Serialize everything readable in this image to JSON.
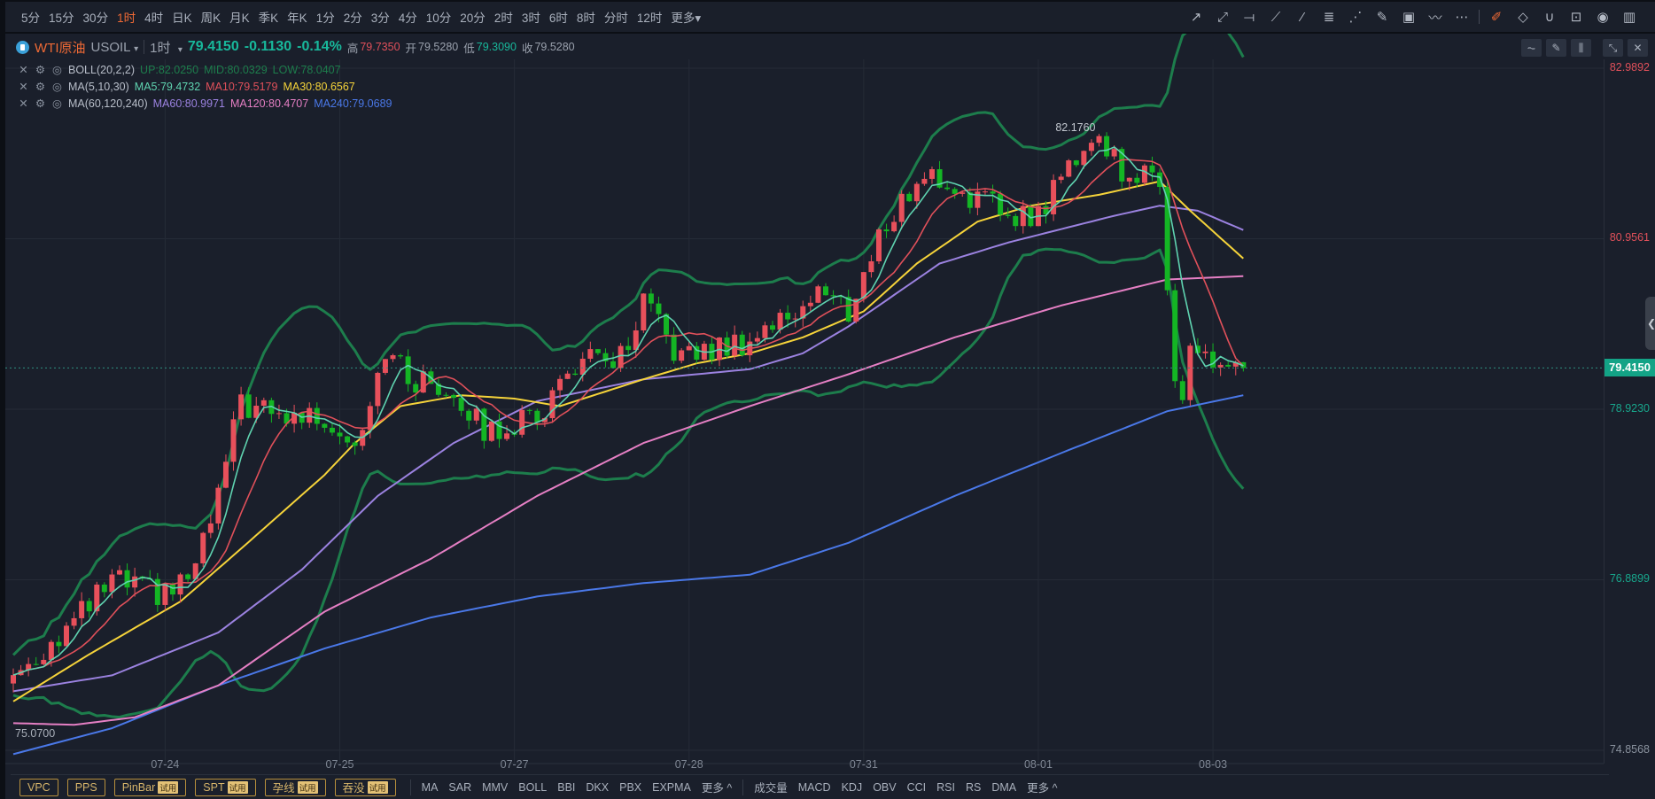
{
  "timeframes": [
    "5分",
    "15分",
    "30分",
    "1时",
    "4时",
    "日K",
    "周K",
    "月K",
    "季K",
    "年K",
    "1分",
    "2分",
    "3分",
    "4分",
    "10分",
    "20分",
    "2时",
    "3时",
    "6时",
    "8时",
    "分时",
    "12时",
    "更多▾"
  ],
  "active_timeframe": "1时",
  "drawing_tools": [
    {
      "icon": "arrow-line-icon",
      "glyph": "↗"
    },
    {
      "icon": "dashed-arrow-icon",
      "glyph": "⤢"
    },
    {
      "icon": "horizontal-line-icon",
      "glyph": "⟞"
    },
    {
      "icon": "price-range-icon",
      "glyph": "⟋"
    },
    {
      "icon": "segment-icon",
      "glyph": "⁄"
    },
    {
      "icon": "fibonacci-icon",
      "glyph": "≣"
    },
    {
      "icon": "fan-icon",
      "glyph": "⋰"
    },
    {
      "icon": "brush-icon",
      "glyph": "✎"
    },
    {
      "icon": "image-icon",
      "glyph": "▣"
    },
    {
      "icon": "pattern-icon",
      "glyph": "〰"
    },
    {
      "icon": "more-icon",
      "glyph": "⋯"
    }
  ],
  "edit_tools": [
    {
      "icon": "draw-mode-icon",
      "glyph": "✐",
      "active": true
    },
    {
      "icon": "eraser-icon",
      "glyph": "◇"
    },
    {
      "icon": "magnet-icon",
      "glyph": "∪"
    },
    {
      "icon": "unlock-icon",
      "glyph": "⊡"
    },
    {
      "icon": "eye-icon",
      "glyph": "◉"
    },
    {
      "icon": "trash-icon",
      "glyph": "▥"
    }
  ],
  "symbol": {
    "name": "WTI原油",
    "code": "USOIL",
    "interval": "1时",
    "price": "79.4150",
    "change": "-0.1130",
    "change_pct": "-0.14%",
    "high_label": "高",
    "high": "79.7350",
    "open_label": "开",
    "open": "79.5280",
    "low_label": "低",
    "low": "79.3090",
    "close_label": "收",
    "close": "79.5280"
  },
  "legend": [
    {
      "name": "BOLL(20,2,2)",
      "values": [
        {
          "t": "UP:82.0250",
          "c": "#1d7d4c"
        },
        {
          "t": "MID:80.0329",
          "c": "#1d7d4c"
        },
        {
          "t": "LOW:78.0407",
          "c": "#1d7d4c"
        }
      ]
    },
    {
      "name": "MA(5,10,30)",
      "values": [
        {
          "t": "MA5:79.4732",
          "c": "#5fd3b0"
        },
        {
          "t": "MA10:79.5179",
          "c": "#e0505a"
        },
        {
          "t": "MA30:80.6567",
          "c": "#f5d33a"
        }
      ]
    },
    {
      "name": "MA(60,120,240)",
      "values": [
        {
          "t": "MA60:80.9971",
          "c": "#9b82e0"
        },
        {
          "t": "MA120:80.4707",
          "c": "#e57fc4"
        },
        {
          "t": "MA240:79.0689",
          "c": "#4a78e8"
        }
      ]
    }
  ],
  "mini_buttons": [
    {
      "icon": "indicator-icon",
      "glyph": "⏦"
    },
    {
      "icon": "pen-icon",
      "glyph": "✎"
    },
    {
      "icon": "candle-type-icon",
      "glyph": "⫼"
    },
    {
      "icon": "shrink-icon",
      "glyph": "⤡"
    },
    {
      "icon": "close-icon",
      "glyph": "✕"
    }
  ],
  "axis_labels": [
    {
      "t": "82.9892",
      "p": 82.9892,
      "c": "#e0505a"
    },
    {
      "t": "80.9561",
      "p": 80.9561,
      "c": "#e0505a"
    },
    {
      "t": "78.9230",
      "p": 78.923,
      "c": "#18a68c"
    },
    {
      "t": "76.8899",
      "p": 76.8899,
      "c": "#18a68c"
    },
    {
      "t": "74.8568",
      "p": 74.8568,
      "c": "#8a929e"
    }
  ],
  "current_price": {
    "t": "79.4150",
    "p": 79.415
  },
  "dates": [
    {
      "t": "07-24",
      "bar": 20
    },
    {
      "t": "07-25",
      "bar": 43
    },
    {
      "t": "07-27",
      "bar": 66
    },
    {
      "t": "07-28",
      "bar": 89
    },
    {
      "t": "07-31",
      "bar": 112
    },
    {
      "t": "08-01",
      "bar": 135
    },
    {
      "t": "08-03",
      "bar": 158
    }
  ],
  "markers": {
    "high": {
      "t": "82.1760",
      "bar": 143,
      "p": 82.176
    },
    "low": {
      "t": "75.0700",
      "bar": 0,
      "p": 75.07
    }
  },
  "bottom": {
    "paid": [
      {
        "t": "VPC"
      },
      {
        "t": "PPS"
      },
      {
        "t": "PinBar",
        "trial": "试用"
      },
      {
        "t": "SPT",
        "trial": "试用"
      },
      {
        "t": "孕线",
        "trial": "试用"
      },
      {
        "t": "吞没",
        "trial": "试用"
      }
    ],
    "main_indicators": [
      "MA",
      "SAR",
      "MMV",
      "BOLL",
      "BBI",
      "DKX",
      "PBX",
      "EXPMA",
      "更多 ^"
    ],
    "sub_indicators": [
      "成交量",
      "MACD",
      "KDJ",
      "OBV",
      "CCI",
      "RSI",
      "RS",
      "DMA",
      "更多 ^"
    ]
  },
  "colors": {
    "up": "#e8505b",
    "down": "#14b524",
    "boll": "#1d7d4c",
    "ma5": "#5fd3b0",
    "ma10": "#e0505a",
    "ma30": "#f5d33a",
    "ma60": "#9b82e0",
    "ma120": "#e57fc4",
    "ma240": "#4a78e8"
  },
  "chart_data": {
    "type": "candlestick",
    "price_range": [
      74.8568,
      82.9892
    ],
    "bars": 163,
    "close_path": [
      [
        0,
        75.75
      ],
      [
        8,
        76.38
      ],
      [
        13,
        76.88
      ],
      [
        20,
        76.69
      ],
      [
        24,
        77.01
      ],
      [
        27,
        77.89
      ],
      [
        30,
        79.02
      ],
      [
        34,
        78.83
      ],
      [
        41,
        78.83
      ],
      [
        45,
        78.52
      ],
      [
        49,
        79.65
      ],
      [
        52,
        79.28
      ],
      [
        58,
        79.15
      ],
      [
        62,
        78.65
      ],
      [
        69,
        78.83
      ],
      [
        74,
        79.47
      ],
      [
        81,
        79.53
      ],
      [
        83,
        80.16
      ],
      [
        88,
        79.53
      ],
      [
        96,
        79.72
      ],
      [
        102,
        80.03
      ],
      [
        106,
        80.35
      ],
      [
        110,
        80.09
      ],
      [
        115,
        81.16
      ],
      [
        120,
        81.73
      ],
      [
        126,
        81.48
      ],
      [
        130,
        81.29
      ],
      [
        135,
        81.23
      ],
      [
        140,
        81.98
      ],
      [
        143,
        82.17
      ],
      [
        146,
        81.79
      ],
      [
        151,
        81.6
      ],
      [
        152,
        80.5
      ],
      [
        153,
        79.4
      ],
      [
        154,
        79.02
      ],
      [
        155,
        79.65
      ],
      [
        158,
        79.47
      ],
      [
        162,
        79.415
      ]
    ],
    "ma30": [
      [
        0,
        75.44
      ],
      [
        10,
        76.0
      ],
      [
        22,
        76.63
      ],
      [
        30,
        77.26
      ],
      [
        41,
        78.14
      ],
      [
        45,
        78.52
      ],
      [
        51,
        78.96
      ],
      [
        59,
        79.09
      ],
      [
        66,
        79.05
      ],
      [
        72,
        78.96
      ],
      [
        83,
        79.28
      ],
      [
        90,
        79.47
      ],
      [
        97,
        79.59
      ],
      [
        104,
        79.78
      ],
      [
        112,
        80.09
      ],
      [
        119,
        80.66
      ],
      [
        127,
        81.16
      ],
      [
        134,
        81.35
      ],
      [
        143,
        81.48
      ],
      [
        151,
        81.64
      ],
      [
        155,
        81.29
      ],
      [
        162,
        80.72
      ]
    ],
    "ma60": [
      [
        0,
        75.56
      ],
      [
        13,
        75.75
      ],
      [
        27,
        76.26
      ],
      [
        38,
        77.01
      ],
      [
        48,
        77.89
      ],
      [
        58,
        78.52
      ],
      [
        69,
        79.02
      ],
      [
        83,
        79.28
      ],
      [
        97,
        79.4
      ],
      [
        104,
        79.59
      ],
      [
        110,
        79.91
      ],
      [
        122,
        80.66
      ],
      [
        131,
        80.91
      ],
      [
        145,
        81.23
      ],
      [
        151,
        81.35
      ],
      [
        156,
        81.29
      ],
      [
        162,
        81.06
      ]
    ],
    "ma120": [
      [
        0,
        75.18
      ],
      [
        8,
        75.16
      ],
      [
        16,
        75.25
      ],
      [
        27,
        75.63
      ],
      [
        41,
        76.51
      ],
      [
        55,
        77.14
      ],
      [
        69,
        77.89
      ],
      [
        83,
        78.52
      ],
      [
        97,
        78.96
      ],
      [
        110,
        79.34
      ],
      [
        124,
        79.78
      ],
      [
        138,
        80.16
      ],
      [
        152,
        80.47
      ],
      [
        162,
        80.51
      ]
    ],
    "ma240": [
      [
        0,
        74.81
      ],
      [
        13,
        75.12
      ],
      [
        27,
        75.63
      ],
      [
        41,
        76.07
      ],
      [
        55,
        76.44
      ],
      [
        69,
        76.69
      ],
      [
        83,
        76.85
      ],
      [
        97,
        76.95
      ],
      [
        110,
        77.33
      ],
      [
        124,
        77.89
      ],
      [
        138,
        78.4
      ],
      [
        152,
        78.9
      ],
      [
        162,
        79.09
      ]
    ]
  }
}
